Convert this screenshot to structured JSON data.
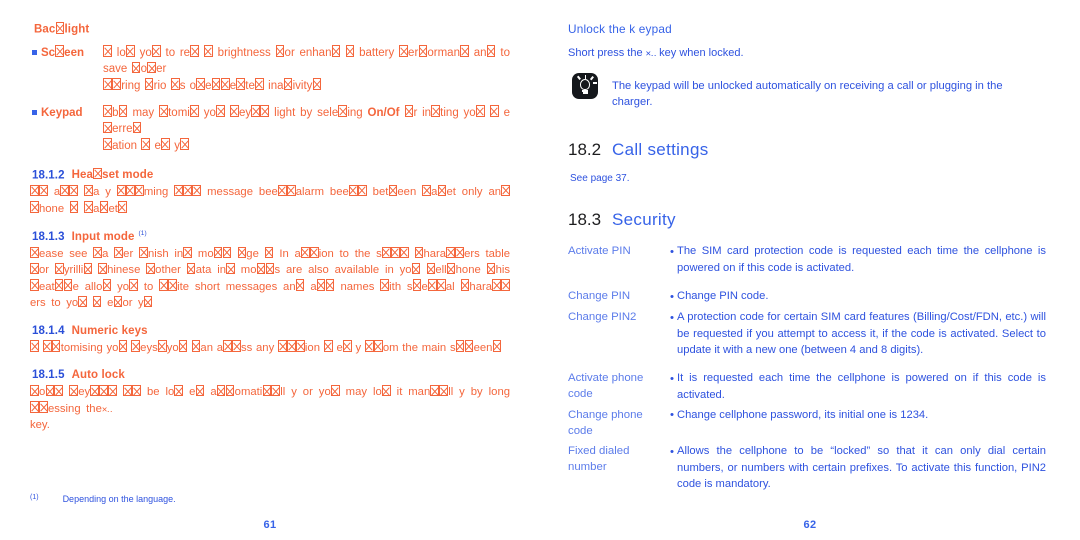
{
  "document": {
    "type": "scanned-manual-spread",
    "colors": {
      "orange": "#F4663C",
      "blue_heading": "#3763E8",
      "blue_body": "#2E52DF",
      "blue_label": "#5C7CEA",
      "section_number": "#1d1d1f",
      "tip_icon_bg": "#15181c"
    }
  },
  "left_page": {
    "backlight_heading": "Bac⌧light",
    "bullets": [
      {
        "term": "Sc⌧een",
        "body_pre": "⌧ lo⌧ yo⌧ to re⌧ ⌧ brightness ⌧or enhan⌧ ⌧ battery ⌧er⌧orman⌧ an⌧ to save ⌧o⌧er",
        "body_post": "⌧⌧ring ⌧rio ⌧s o⌧e⌧⌧e⌧te⌧ ina⌧ivity⌧"
      },
      {
        "term": "Keypad",
        "body_pre": "⌧b⌧ may ⌧tomi⌧ yo⌧ ⌧ey⌧⌧ light by sele⌧ing",
        "body_bold": "On/Of",
        "body_mid": "⌧r in⌧ting yo⌧ ⌧ e⌧erre⌧",
        "body_post": "⌧ation ⌧ e⌧ y⌧"
      }
    ],
    "sections": [
      {
        "number": "18.1.2",
        "title": "Hea⌧set mode",
        "footnote_marker": "",
        "paragraphs": [
          "⌧⌧ a⌧⌧ ⌧a y ⌧⌧⌧ming ⌧⌧⌧ message bee⌧⌧alarm bee⌧⌧ bet⌧een ⌧a⌧et only an⌧ ⌧hone ⌧ ⌧a⌧et⌧"
        ]
      },
      {
        "number": "18.1.3",
        "title": "Input mode",
        "footnote_marker": "(1)",
        "paragraphs": [
          "⌧ease see ⌧a ⌧er ⌧nish in⌧ mo⌧⌧ ⌧ge ⌧ In a⌧⌧ion to the s⌧⌧⌧ ⌧hara⌧⌧ers table ⌧or ⌧yrilli⌧ ⌧hinese ⌧other ⌧ata in⌧ mo⌧⌧s are also available in yo⌧ ⌧ell⌧hone ⌧his ⌧eat⌧⌧e allo⌧ yo⌧ to ⌧⌧ite short messages an⌧ a⌧⌧ names ⌧ith s⌧e⌧⌧al ⌧hara⌧⌧ers to yo⌧ ⌧ e⌧or y⌧"
        ]
      },
      {
        "number": "18.1.4",
        "title": "Numeric keys",
        "footnote_marker": "",
        "paragraphs": [
          "⌧ ⌧⌧tomising yo⌧ ⌧eys⌧yo⌧ ⌧an a⌧⌧ss any ⌧⌧⌧ion ⌧ e⌧ y ⌧⌧om the main s⌧⌧een⌧"
        ]
      },
      {
        "number": "18.1.5",
        "title": "Auto lock",
        "footnote_marker": "",
        "paragraphs": [
          "⌧o⌧⌧ ⌧ey⌧⌧⌧ ⌧⌧ be lo⌧ e⌧ a⌧⌧omati⌧⌧ll y or yo⌧ may lo⌧ it man⌧⌧ll y by long ⌧⌧essing the",
          "key."
        ],
        "key_glyph": "✕‥"
      }
    ],
    "footnote": {
      "marker": "(1)",
      "text": "Depending on the language."
    },
    "folio": "61"
  },
  "right_page": {
    "unlock_heading": "Unlock the k eypad",
    "unlock_line_pre": "Short press the",
    "unlock_key_glyph": "✕‥",
    "unlock_line_post": "key when locked.",
    "tip": {
      "icon": "lightbulb-tip-icon",
      "text": "The keypad will be unlocked automatically on receiving a call or plugging in the charger."
    },
    "section_call_settings": {
      "number": "18.2",
      "title": "Call settings",
      "body": "See page 37."
    },
    "section_security": {
      "number": "18.3",
      "title": "Security",
      "rows": [
        {
          "label": "Activate PIN",
          "desc": "The SIM card protection code is requested each time the cellphone is powered on if this code is activated."
        },
        {
          "label": "Change PIN",
          "desc": "Change PIN code."
        },
        {
          "label": "Change PIN2",
          "desc": "A protection code for certain SIM card features (Billing/Cost/FDN, etc.) will be requested if you attempt to access it, if the code is activated. Select to update it with a new one (between 4 and 8 digits)."
        },
        {
          "label": "Activate phone code",
          "desc": "It is requested each time the cellphone is powered on if this code is activated."
        },
        {
          "label": "Change phone code",
          "desc": "Change cellphone password, its initial one is 1234."
        },
        {
          "label": "Fixed dialed number",
          "desc": "Allows the cellphone to be “locked” so that it can only dial certain numbers, or numbers with certain prefixes. To activate this function, PIN2 code is mandatory."
        }
      ]
    },
    "folio": "62"
  }
}
